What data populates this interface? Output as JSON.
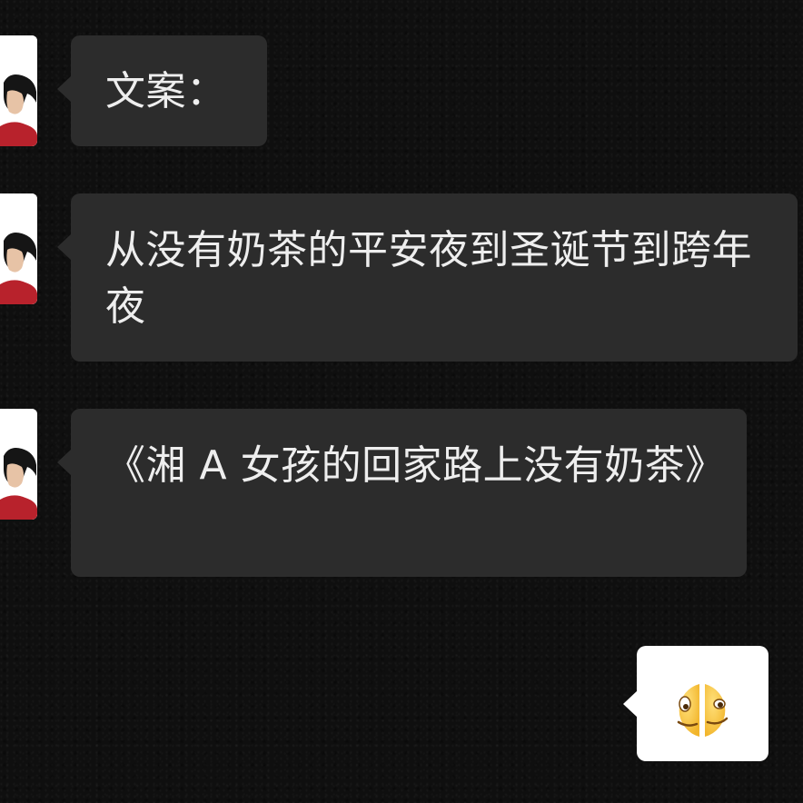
{
  "messages": [
    {
      "sender": "contact",
      "text": "文案："
    },
    {
      "sender": "contact",
      "text": "从没有奶茶的平安夜到圣诞节到跨年夜"
    },
    {
      "sender": "contact",
      "text": "《湘 A 女孩的回家路上没有奶茶》"
    },
    {
      "sender": "self",
      "sticker": "split-face-emoji"
    }
  ],
  "colors": {
    "background": "#0f0f0f",
    "incoming_bubble": "#2c2c2c",
    "incoming_text": "#eeeeee",
    "outgoing_bubble": "#ffffff",
    "avatar_shirt": "#b8222c"
  },
  "icons": {
    "avatar": "contact-avatar-icon",
    "sticker": "split-face-emoji-icon"
  }
}
